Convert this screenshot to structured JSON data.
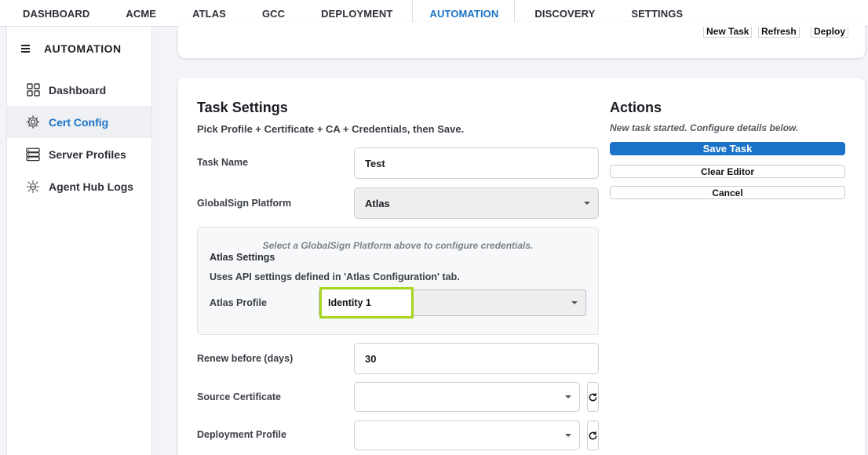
{
  "topnav": {
    "tabs": [
      {
        "label": "DASHBOARD"
      },
      {
        "label": "ACME"
      },
      {
        "label": "ATLAS"
      },
      {
        "label": "GCC"
      },
      {
        "label": "DEPLOYMENT"
      },
      {
        "label": "AUTOMATION"
      },
      {
        "label": "DISCOVERY"
      },
      {
        "label": "SETTINGS"
      }
    ],
    "active": "AUTOMATION"
  },
  "sidebar": {
    "title": "AUTOMATION",
    "items": [
      {
        "label": "Dashboard",
        "icon": "grid-icon"
      },
      {
        "label": "Cert Config",
        "icon": "gear-icon"
      },
      {
        "label": "Server Profiles",
        "icon": "server-icon"
      },
      {
        "label": "Agent Hub Logs",
        "icon": "api-hub-icon"
      }
    ],
    "active": "Cert Config"
  },
  "toolbar": {
    "new_task": "New Task",
    "refresh": "Refresh",
    "deploy": "Deploy"
  },
  "task_settings": {
    "title": "Task Settings",
    "subtitle": "Pick Profile + Certificate + CA + Credentials, then Save.",
    "task_name_label": "Task Name",
    "task_name_value": "Test",
    "platform_label": "GlobalSign Platform",
    "platform_value": "Atlas",
    "cred_note": "Select a GlobalSign Platform above to configure credentials.",
    "atlas_settings_title": "Atlas Settings",
    "atlas_settings_desc": "Uses API settings defined in 'Atlas Configuration' tab.",
    "atlas_profile_label": "Atlas Profile",
    "atlas_profile_value": "Identity 1",
    "renew_label": "Renew before (days)",
    "renew_value": "30",
    "source_cert_label": "Source Certificate",
    "source_cert_value": "",
    "deploy_profile_label": "Deployment Profile",
    "deploy_profile_value": ""
  },
  "actions": {
    "title": "Actions",
    "status": "New task started. Configure details below.",
    "save": "Save Task",
    "clear": "Clear Editor",
    "cancel": "Cancel"
  },
  "colors": {
    "accent": "#1a73c8",
    "highlight": "#a6d51e"
  }
}
